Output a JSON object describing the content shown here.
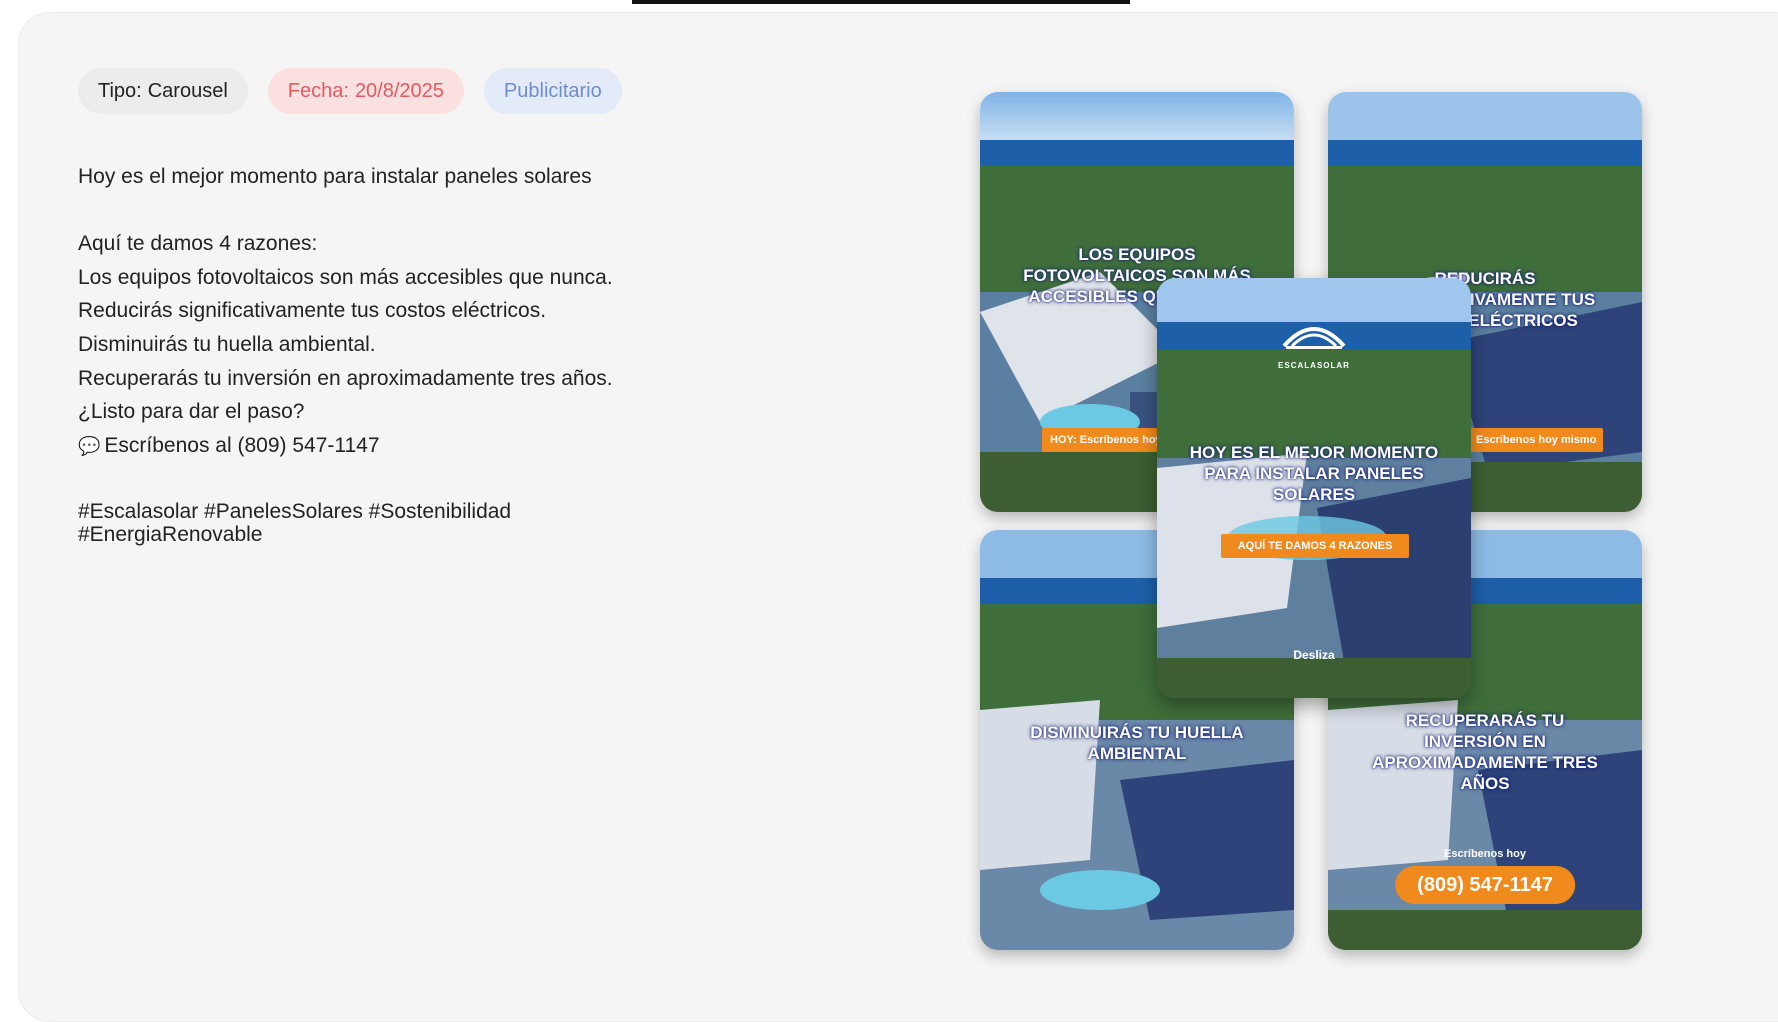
{
  "tags": {
    "tipo_label": "Tipo:",
    "tipo_value": "Carousel",
    "fecha_label": "Fecha:",
    "fecha_value": "20/8/2025",
    "category": "Publicitario"
  },
  "caption": {
    "line1": "Hoy es el mejor momento para instalar paneles solares",
    "line2": "Aquí te damos 4 razones:",
    "line3": "Los equipos fotovoltaicos son más accesibles que nunca.",
    "line4": "Reducirás significativamente tus costos eléctricos.",
    "line5": "Disminuirás tu huella ambiental.",
    "line6": "Recuperarás tu inversión en aproximadamente tres años.",
    "line7": "¿Listo para dar el paso?",
    "line8_icon": "speech-bubble-icon",
    "line8": "Escríbenos al (809) 547-1147",
    "hashtags": "#Escalasolar #PanelesSolares #Sostenibilidad #EnergiaRenovable"
  },
  "slides": {
    "slide1": {
      "headline": "LOS EQUIPOS FOTOVOLTAICOS SON MÁS ACCESIBLES QUE NUNCA",
      "strip": "HOY: Escríbenos hoy"
    },
    "slide2": {
      "headline": "REDUCIRÁS SIGNIFICATIVAMENTE TUS COSTOS ELÉCTRICOS",
      "strip": "Escríbenos hoy mismo"
    },
    "slide3": {
      "headline": "DISMINUIRÁS TU HUELLA AMBIENTAL"
    },
    "slide4": {
      "headline": "RECUPERARÁS TU INVERSIÓN EN APROXIMADAMENTE TRES AÑOS",
      "small": "Escríbenos hoy",
      "phone": "(809) 547-1147"
    },
    "cover": {
      "logo": "ESCALASOLAR",
      "headline": "HOY ES EL MEJOR MOMENTO PARA INSTALAR PANELES SOLARES",
      "strip": "AQUÍ TE DAMOS 4 RAZONES",
      "brand": "Desliza"
    }
  },
  "colors": {
    "accent_orange": "#f08a1c",
    "headline_text": "#ffffff",
    "fecha_red": "#e45a62",
    "pub_blue": "#6d8ed0"
  }
}
